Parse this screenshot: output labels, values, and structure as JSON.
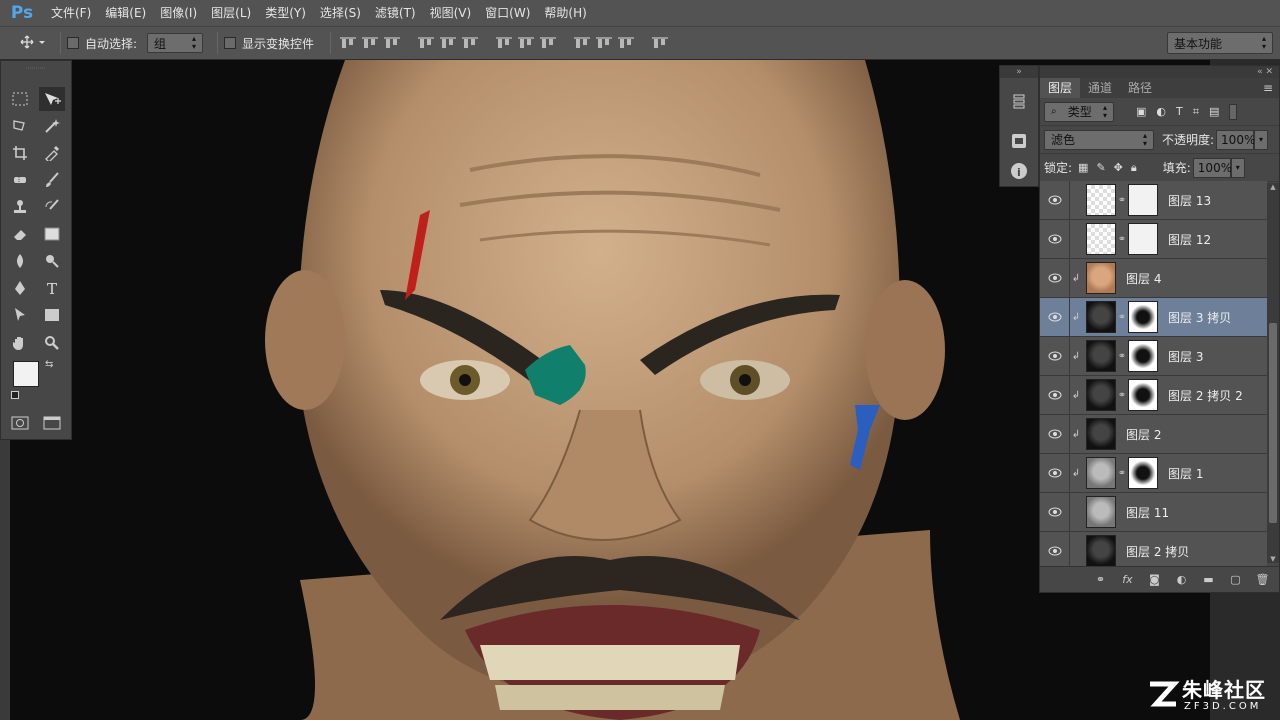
{
  "app": {
    "logo": "Ps"
  },
  "menubar": [
    "文件(F)",
    "编辑(E)",
    "图像(I)",
    "图层(L)",
    "类型(Y)",
    "选择(S)",
    "滤镜(T)",
    "视图(V)",
    "窗口(W)",
    "帮助(H)"
  ],
  "options": {
    "auto_select_label": "自动选择:",
    "auto_select_value": "组",
    "show_transform_label": "显示变换控件",
    "workspace": "基本功能"
  },
  "layers_panel": {
    "tabs": [
      "图层",
      "通道",
      "路径"
    ],
    "filter_kind": "类型",
    "blend_mode": "滤色",
    "opacity_label": "不透明度:",
    "opacity_value": "100%",
    "lock_label": "锁定:",
    "fill_label": "填充:",
    "fill_value": "100%",
    "layers": [
      {
        "name": "图层 13",
        "selected": false,
        "clipped": false,
        "mask": true,
        "thumb": "checker"
      },
      {
        "name": "图层 12",
        "selected": false,
        "clipped": false,
        "mask": true,
        "thumb": "checker"
      },
      {
        "name": "图层 4",
        "selected": false,
        "clipped": true,
        "mask": false,
        "thumb": "skin"
      },
      {
        "name": "图层 3 拷贝",
        "selected": true,
        "clipped": true,
        "mask": true,
        "thumb": "dark"
      },
      {
        "name": "图层 3",
        "selected": false,
        "clipped": true,
        "mask": true,
        "thumb": "dark"
      },
      {
        "name": "图层 2 拷贝 2",
        "selected": false,
        "clipped": true,
        "mask": true,
        "thumb": "dark"
      },
      {
        "name": "图层 2",
        "selected": false,
        "clipped": true,
        "mask": false,
        "thumb": "dark"
      },
      {
        "name": "图层 1",
        "selected": false,
        "clipped": true,
        "mask": true,
        "thumb": "grey"
      },
      {
        "name": "图层 11",
        "selected": false,
        "clipped": false,
        "mask": false,
        "thumb": "grey"
      },
      {
        "name": "图层 2 拷贝",
        "selected": false,
        "clipped": false,
        "mask": false,
        "thumb": "dark"
      }
    ]
  },
  "watermark": {
    "title": "朱峰社区",
    "url": "ZF3D.COM"
  }
}
